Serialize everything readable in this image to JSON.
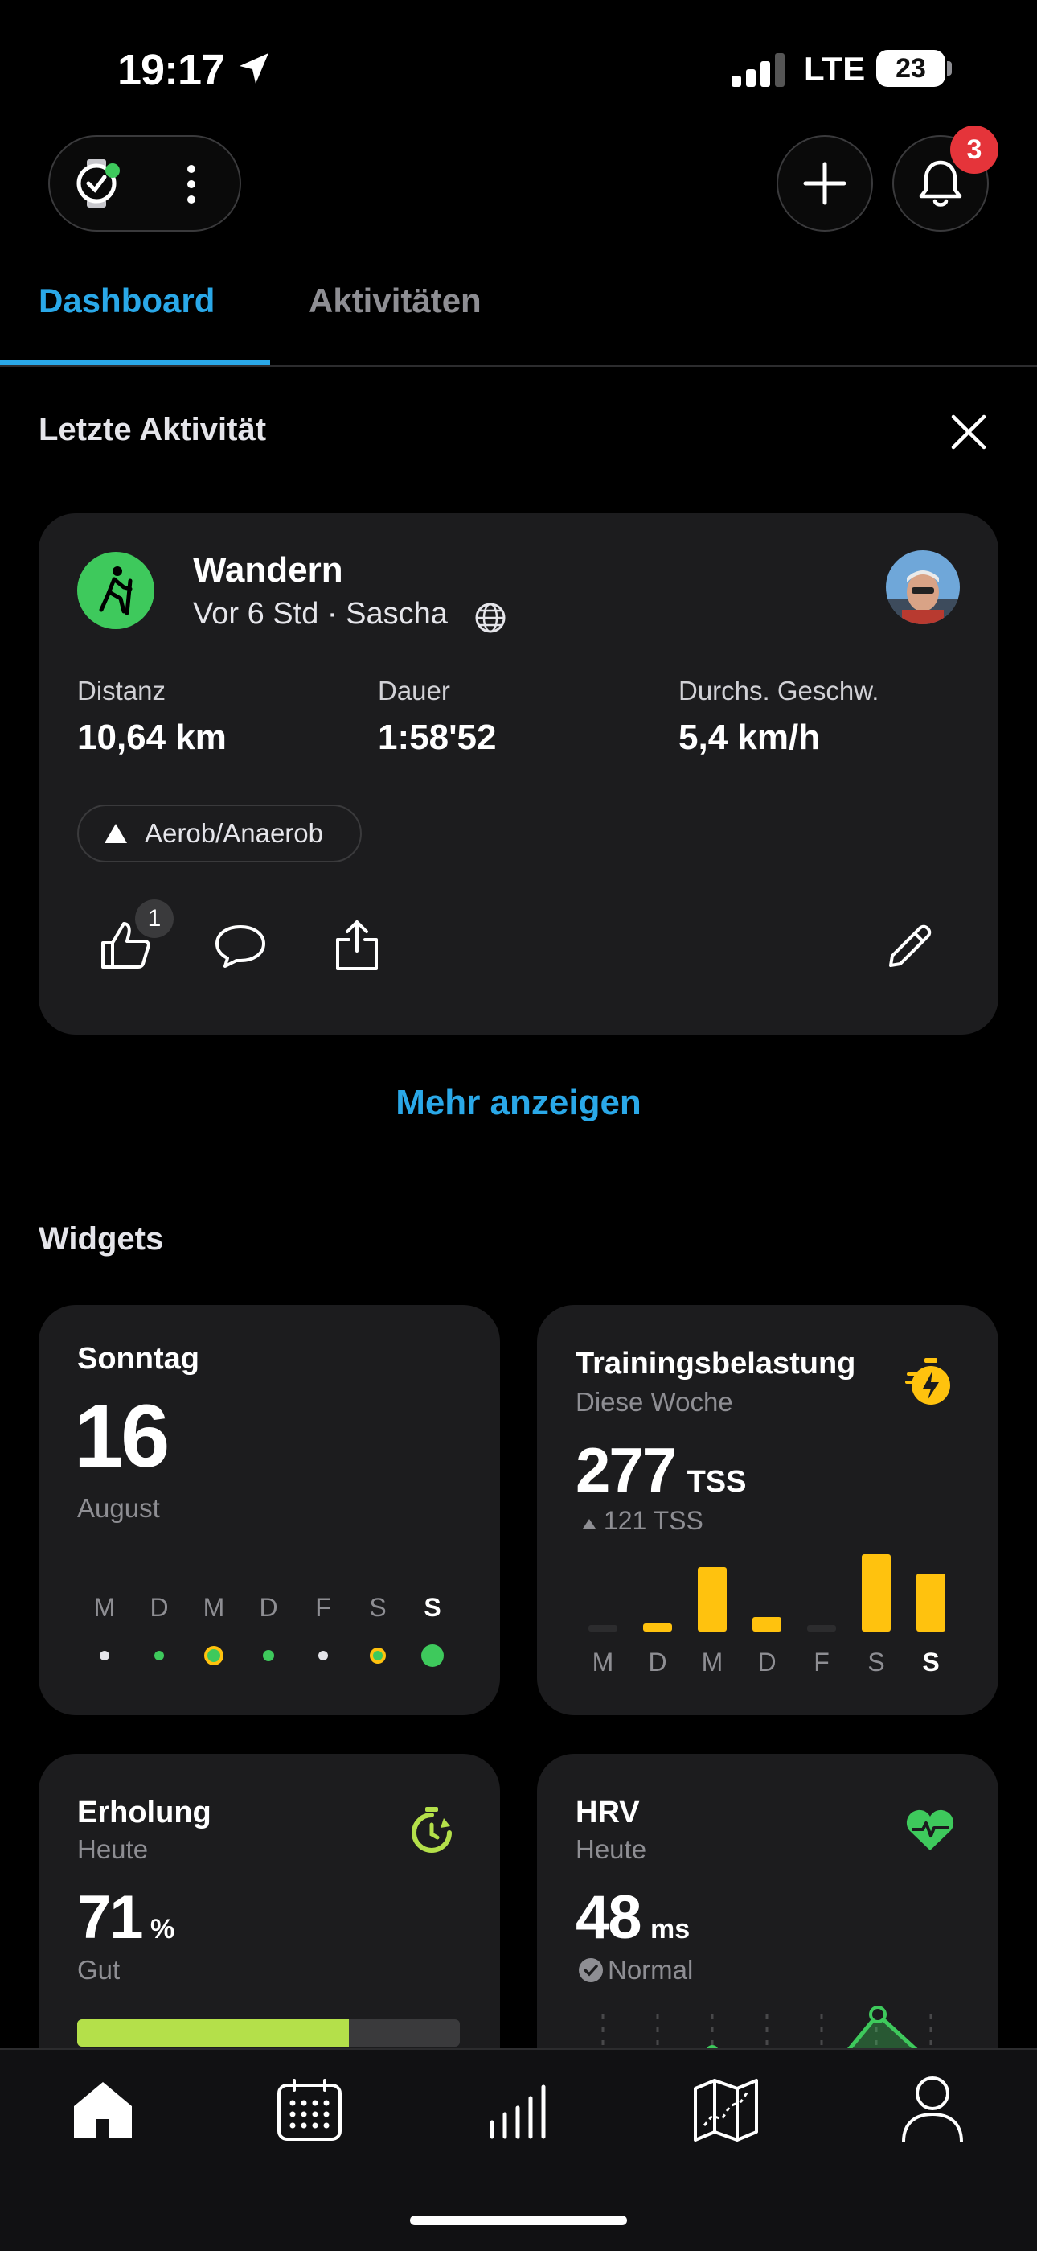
{
  "status_bar": {
    "time": "19:17",
    "network": "LTE",
    "battery": "23"
  },
  "header": {
    "notification_count": "3"
  },
  "tabs": [
    {
      "label": "Dashboard",
      "active": true
    },
    {
      "label": "Aktivitäten",
      "active": false
    }
  ],
  "last_activity": {
    "section_title": "Letzte Aktivität",
    "activity_type": "Wandern",
    "subtitle": "Vor 6 Std · Sascha",
    "stats": [
      {
        "label": "Distanz",
        "value": "10,64 km"
      },
      {
        "label": "Dauer",
        "value": "1:58'52"
      },
      {
        "label": "Durchs. Geschw.",
        "value": "5,4 km/h"
      }
    ],
    "tag": "Aerob/Anaerob",
    "like_count": "1",
    "more_link": "Mehr anzeigen"
  },
  "widgets": {
    "section_title": "Widgets",
    "calendar": {
      "weekday": "Sonntag",
      "day": "16",
      "month": "August",
      "days": [
        "M",
        "D",
        "M",
        "D",
        "F",
        "S",
        "S"
      ]
    },
    "training_load": {
      "title": "Trainingsbelastung",
      "subtitle": "Diese Woche",
      "value": "277",
      "unit": "TSS",
      "delta": "121 TSS",
      "days": [
        "M",
        "D",
        "M",
        "D",
        "F",
        "S",
        "S"
      ],
      "bar_values": [
        0,
        8,
        80,
        18,
        0,
        96,
        72
      ],
      "accent": "#ffc20e"
    },
    "recovery": {
      "title": "Erholung",
      "subtitle": "Heute",
      "value": "71",
      "unit": "%",
      "status": "Gut",
      "progress": 0.71,
      "accent": "#b4e04a"
    },
    "hrv": {
      "title": "HRV",
      "subtitle": "Heute",
      "value": "48",
      "unit": "ms",
      "status": "Normal",
      "accent": "#3ec95c"
    }
  },
  "bottom_nav": [
    "home-icon",
    "calendar-icon",
    "stats-icon",
    "map-icon",
    "profile-icon"
  ]
}
